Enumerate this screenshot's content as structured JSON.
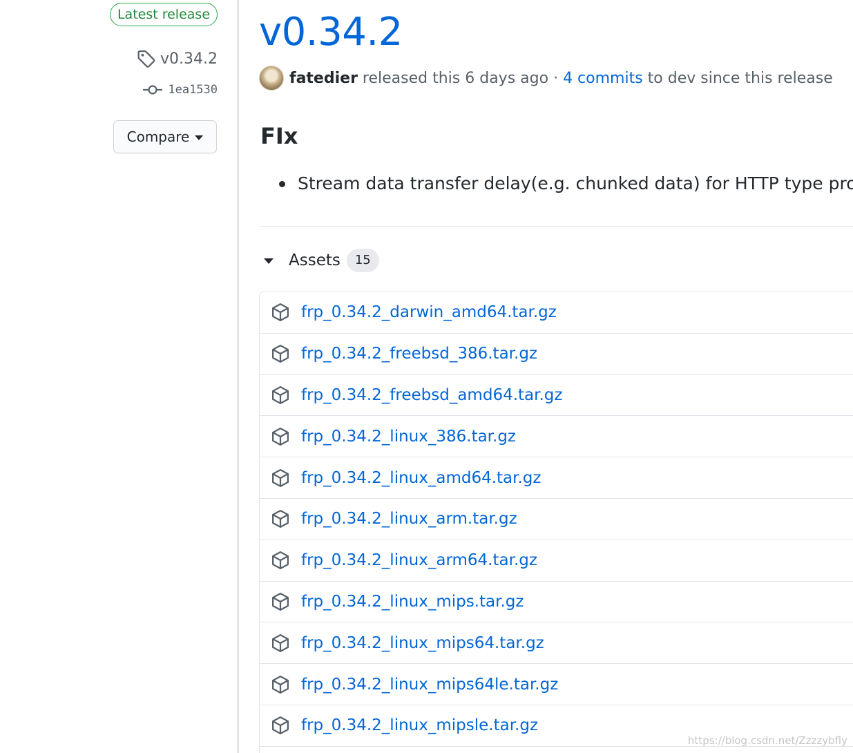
{
  "sidebar": {
    "latest_badge": "Latest release",
    "tag_name": "v0.34.2",
    "commit_sha": "1ea1530",
    "compare_label": "Compare"
  },
  "release": {
    "title": "v0.34.2",
    "author": "fatedier",
    "released_text": "released this 6 days ago",
    "separator": "·",
    "commits_link": "4 commits",
    "commits_suffix": "to dev since this release"
  },
  "notes": {
    "heading": "FIx",
    "items": [
      "Stream data transfer delay(e.g. chunked data) for HTTP type proxy"
    ]
  },
  "assets": {
    "label": "Assets",
    "count": "15",
    "files": [
      "frp_0.34.2_darwin_amd64.tar.gz",
      "frp_0.34.2_freebsd_386.tar.gz",
      "frp_0.34.2_freebsd_amd64.tar.gz",
      "frp_0.34.2_linux_386.tar.gz",
      "frp_0.34.2_linux_amd64.tar.gz",
      "frp_0.34.2_linux_arm.tar.gz",
      "frp_0.34.2_linux_arm64.tar.gz",
      "frp_0.34.2_linux_mips.tar.gz",
      "frp_0.34.2_linux_mips64.tar.gz",
      "frp_0.34.2_linux_mips64le.tar.gz",
      "frp_0.34.2_linux_mipsle.tar.gz"
    ]
  },
  "watermark": "https://blog.csdn.net/Zzzzybfly",
  "colors": {
    "link": "#0366d6",
    "text": "#24292e",
    "muted": "#586069",
    "success": "#28a745",
    "border": "#e1e4e8"
  },
  "icons": {
    "tag": "tag-icon",
    "commit": "git-commit-icon",
    "package": "package-icon",
    "caret": "caret-down-icon"
  }
}
